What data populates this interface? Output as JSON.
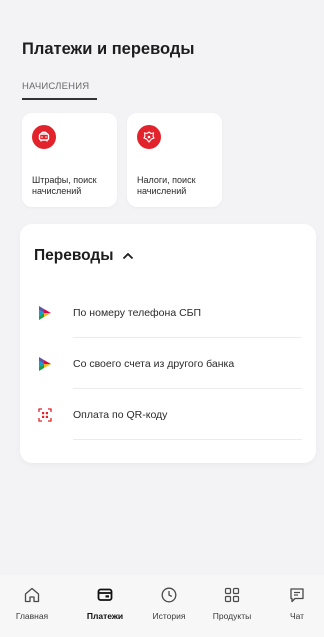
{
  "page": {
    "title": "Платежи и переводы",
    "tab_label": "НАЧИСЛЕНИЯ"
  },
  "tiles": [
    {
      "label": "Штрафы, поиск начислений",
      "icon": "car-icon"
    },
    {
      "label": "Налоги, поиск начислений",
      "icon": "tax-emblem-icon"
    }
  ],
  "transfers": {
    "title": "Переводы",
    "items": [
      {
        "label": "По номеру телефона СБП",
        "icon": "sbp-icon"
      },
      {
        "label": "Со своего счета из другого банка",
        "icon": "sbp-icon"
      },
      {
        "label": "Оплата по QR-коду",
        "icon": "qr-code-icon"
      }
    ]
  },
  "nav": {
    "items": [
      {
        "label": "Главная",
        "icon": "home-icon"
      },
      {
        "label": "Платежи",
        "icon": "payments-icon"
      },
      {
        "label": "История",
        "icon": "clock-icon"
      },
      {
        "label": "Продукты",
        "icon": "grid-icon"
      },
      {
        "label": "Чат",
        "icon": "chat-icon"
      }
    ]
  },
  "colors": {
    "accent_red": "#e2232b",
    "background": "#f3f3f5"
  }
}
